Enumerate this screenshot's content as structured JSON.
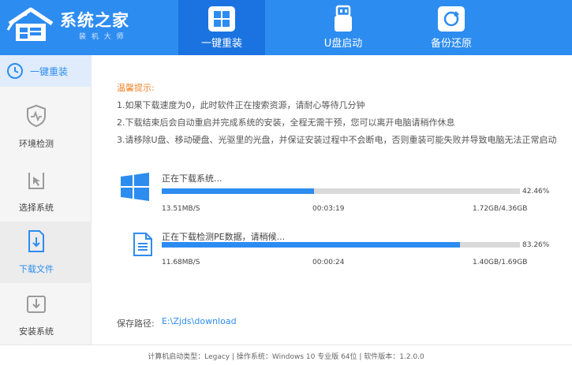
{
  "brand": {
    "title": "系统之家",
    "subtitle": "装 机 大 师",
    "logo_icon": "house-logo-icon"
  },
  "nav": {
    "tabs": [
      {
        "label": "一键重装",
        "icon": "windows-reinstall-icon",
        "active": true
      },
      {
        "label": "U盘启动",
        "icon": "usb-drive-icon",
        "active": false
      },
      {
        "label": "备份还原",
        "icon": "backup-restore-icon",
        "active": false
      }
    ]
  },
  "sidebar": {
    "top": {
      "label": "一键重装",
      "icon": "reinstall-icon"
    },
    "items": [
      {
        "label": "环境检测",
        "icon": "shield-pulse-icon"
      },
      {
        "label": "选择系统",
        "icon": "cursor-select-icon"
      },
      {
        "label": "下载文件",
        "icon": "download-file-icon",
        "active": true
      },
      {
        "label": "安装系统",
        "icon": "install-box-icon"
      }
    ]
  },
  "tips": {
    "title": "温馨提示:",
    "items": [
      "1.如果下载速度为0，此时软件正在搜索资源，请耐心等待几分钟",
      "2.下载结束后会自动重启并完成系统的安装，全程无需干预，您可以离开电脑请稍作休息",
      "3.请移除U盘、移动硬盘、光驱里的光盘，并保证安装过程中不会断电，否则重装可能失败并导致电脑无法正常启动"
    ]
  },
  "downloads": [
    {
      "icon": "windows-logo-icon",
      "status": "正在下载系统...",
      "percent": "42.46%",
      "progress": 0.4246,
      "speed": "13.51MB/S",
      "time": "00:03:19",
      "size": "1.72GB/4.36GB"
    },
    {
      "icon": "document-icon",
      "status": "正在下载检测PE数据，请稍候...",
      "percent": "83.26%",
      "progress": 0.8326,
      "speed": "11.68MB/S",
      "time": "00:00:24",
      "size": "1.40GB/1.69GB"
    }
  ],
  "save": {
    "label": "保存路径:",
    "path": "E:\\Zjds\\download"
  },
  "footer": {
    "text": "计算机启动类型：Legacy | 操作系统：Windows 10 专业版 64位 | 软件版本：1.2.0.0"
  },
  "colors": {
    "accent": "#2d8cf0",
    "tip_title": "#f0832a"
  }
}
